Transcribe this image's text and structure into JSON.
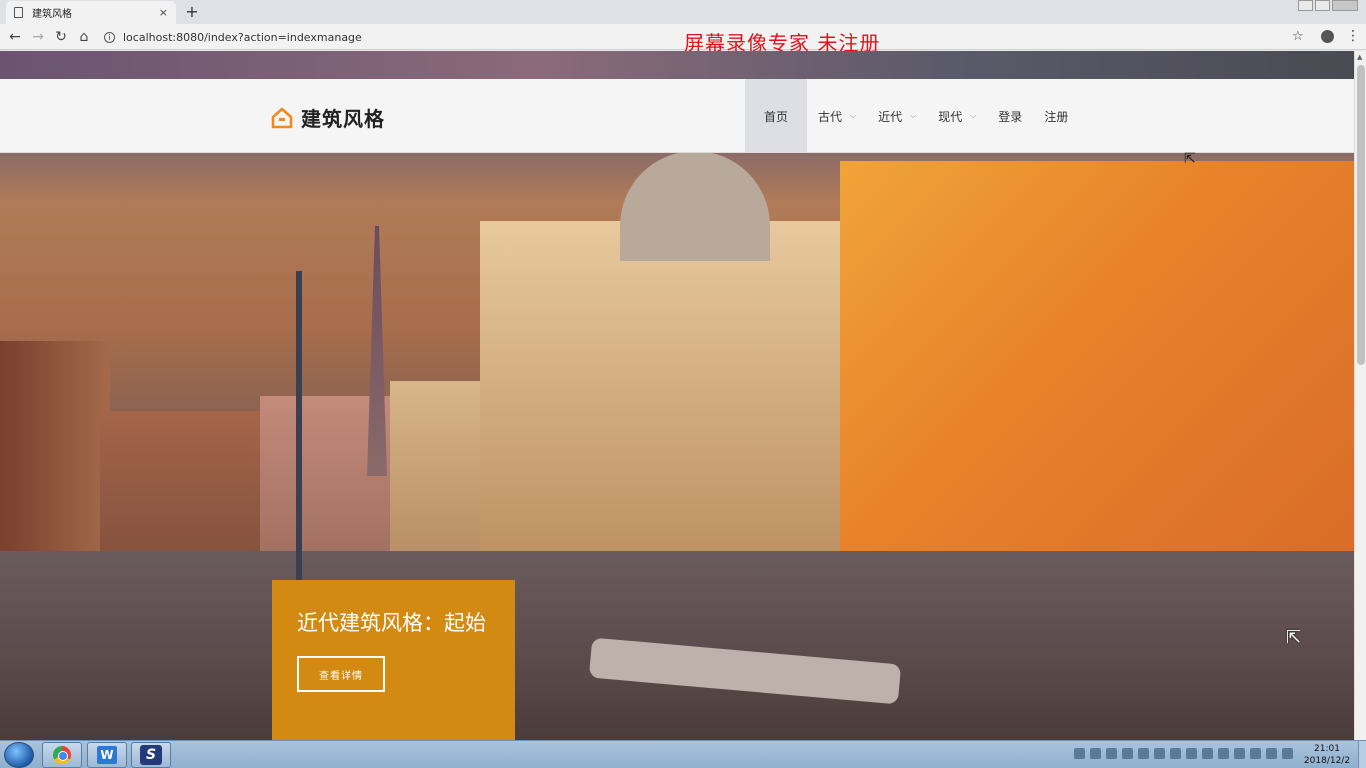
{
  "browser": {
    "tab_title": "建筑风格",
    "tab_close": "×",
    "new_tab": "+",
    "url": "localhost:8080/index?action=indexmanage",
    "back": "←",
    "forward": "→",
    "reload": "↻",
    "home": "⌂",
    "star": "☆",
    "menu": "⋮",
    "watermark": "屏幕录像专家  未注册"
  },
  "site": {
    "logo_text": "建筑风格",
    "brand_color": "#f08a1e",
    "nav": [
      {
        "label": "首页",
        "active": true
      },
      {
        "label": "古代",
        "dropdown": true
      },
      {
        "label": "近代",
        "dropdown": true
      },
      {
        "label": "现代",
        "dropdown": true
      },
      {
        "label": "登录"
      },
      {
        "label": "注册"
      }
    ],
    "chevron": "⌵"
  },
  "hero": {
    "caption_title": "近代建筑风格：起始",
    "caption_button": "查看详情",
    "caption_bg": "#d28a12"
  },
  "taskbar": {
    "time": "21:01",
    "date": "2018/12/2",
    "apps": [
      "chrome-icon",
      "word-icon",
      "s-app-icon"
    ],
    "app_w_glyph": "W",
    "app_s_glyph": "S"
  }
}
